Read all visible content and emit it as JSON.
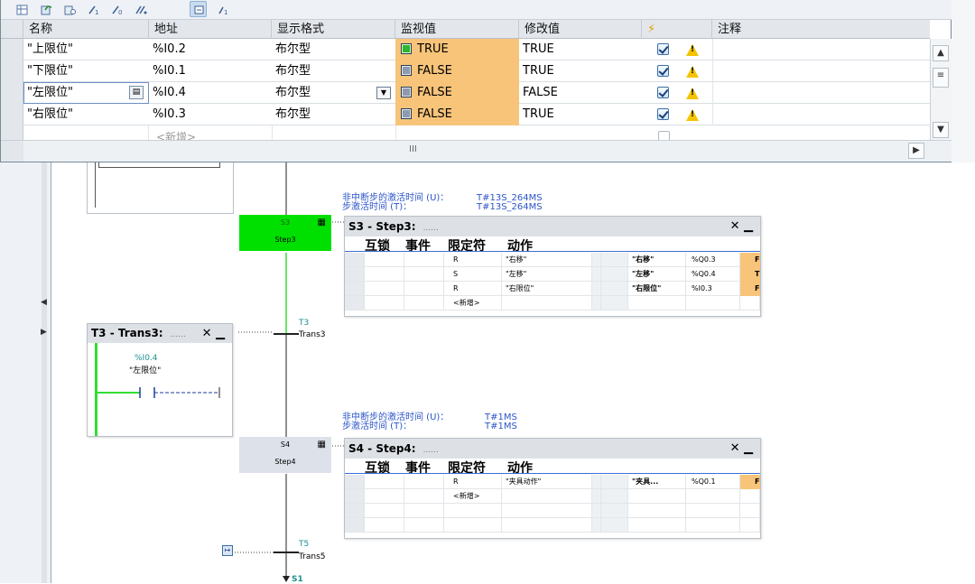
{
  "watch_table": {
    "toolbar_buttons": [
      "table-view-icon",
      "monitor-all-icon",
      "monitor-once-icon",
      "modify-icon",
      "modify-value-icon",
      "modify-all-icon",
      "force-icon",
      "force-value-icon"
    ],
    "columns": {
      "name": "名称",
      "address": "地址",
      "display_format": "显示格式",
      "monitor_value": "监视值",
      "modify_value": "修改值",
      "lightning": "⚡",
      "comment": "注释"
    },
    "rows": [
      {
        "name": "\"上限位\"",
        "address": "%I0.2",
        "format": "布尔型",
        "monitor": "TRUE",
        "monitor_state": "true",
        "modify": "TRUE",
        "checked": true
      },
      {
        "name": "\"下限位\"",
        "address": "%I0.1",
        "format": "布尔型",
        "monitor": "FALSE",
        "monitor_state": "false",
        "modify": "TRUE",
        "checked": true
      },
      {
        "name": "\"左限位\"",
        "address": "%I0.4",
        "format": "布尔型",
        "monitor": "FALSE",
        "monitor_state": "false",
        "modify": "FALSE",
        "checked": true
      },
      {
        "name": "\"右限位\"",
        "address": "%I0.3",
        "format": "布尔型",
        "monitor": "FALSE",
        "monitor_state": "false",
        "modify": "TRUE",
        "checked": true
      }
    ],
    "add_new": "<新增>",
    "hscroll_thumb": "III"
  },
  "graph": {
    "step3": {
      "number": "S3",
      "name": "Step3",
      "active": true,
      "timing_u_label": "非中断步的激活时间 (U)：",
      "timing_u_value": "T#13S_264MS",
      "timing_t_label": "步激活时间 (T)：",
      "timing_t_value": "T#13S_264MS",
      "panel_title": "S3 - Step3:",
      "panel_dots": "......",
      "cols": [
        "互锁",
        "事件",
        "限定符",
        "动作"
      ],
      "actions": [
        {
          "qualifier": "R",
          "action": "\"右移\""
        },
        {
          "qualifier": "S",
          "action": "\"左移\""
        },
        {
          "qualifier": "R",
          "action": "\"右限位\""
        },
        {
          "qualifier": "",
          "action": "<新增>"
        }
      ],
      "vars": [
        {
          "name": "\"右移\"",
          "addr": "%Q0.3",
          "val": "F"
        },
        {
          "name": "\"左移\"",
          "addr": "%Q0.4",
          "val": "T"
        },
        {
          "name": "\"右限位\"",
          "addr": "%I0.3",
          "val": "F"
        }
      ]
    },
    "trans3": {
      "label": "T3",
      "name": "Trans3",
      "panel_title": "T3 - Trans3:",
      "panel_dots": "......",
      "contact_addr": "%I0.4",
      "contact_name": "\"左限位\""
    },
    "step4": {
      "number": "S4",
      "name": "Step4",
      "active": false,
      "timing_u_label": "非中断步的激活时间 (U)：",
      "timing_u_value": "T#1MS",
      "timing_t_label": "步激活时间 (T)：",
      "timing_t_value": "T#1MS",
      "panel_title": "S4 - Step4:",
      "panel_dots": "......",
      "cols": [
        "互锁",
        "事件",
        "限定符",
        "动作"
      ],
      "actions": [
        {
          "qualifier": "R",
          "action": "\"夹具动作\""
        },
        {
          "qualifier": "",
          "action": "<新增>"
        }
      ],
      "vars": [
        {
          "name": "\"夹具...",
          "addr": "%Q0.1",
          "val": "F"
        }
      ]
    },
    "trans5": {
      "label": "T5",
      "name": "Trans5"
    },
    "next_step": {
      "label": "S1"
    },
    "colors": {
      "active_step": "#00e000",
      "inactive_step": "#dde2ea",
      "monitor_cell": "#f7c47a",
      "power_flow": "#33dd33",
      "timing_text": "#2b54c9"
    }
  }
}
